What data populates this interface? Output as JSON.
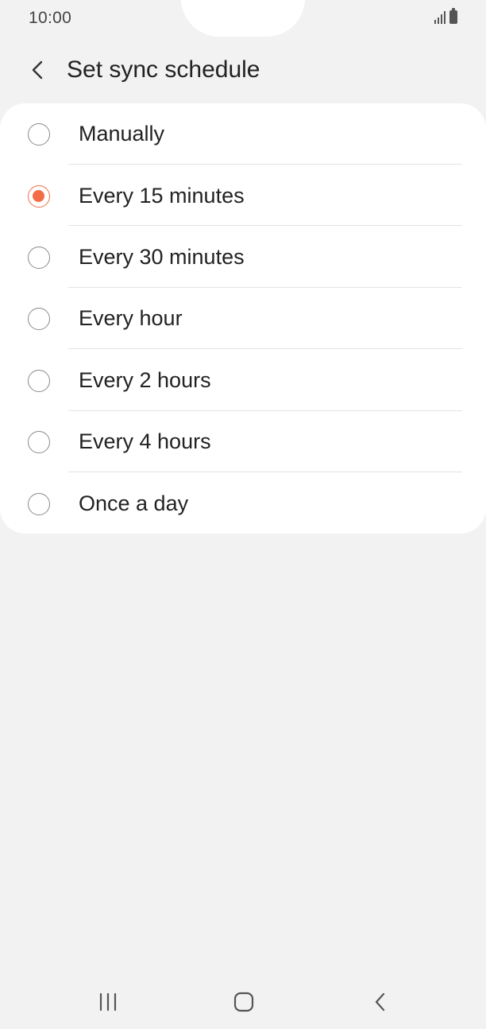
{
  "status_bar": {
    "time": "10:00"
  },
  "header": {
    "title": "Set sync schedule",
    "back_icon": "chevron-left-icon"
  },
  "options": [
    {
      "label": "Manually",
      "selected": false
    },
    {
      "label": "Every 15 minutes",
      "selected": true
    },
    {
      "label": "Every 30 minutes",
      "selected": false
    },
    {
      "label": "Every hour",
      "selected": false
    },
    {
      "label": "Every 2 hours",
      "selected": false
    },
    {
      "label": "Every 4 hours",
      "selected": false
    },
    {
      "label": "Once a day",
      "selected": false
    }
  ],
  "colors": {
    "accent": "#f26d47",
    "background": "#f2f2f2",
    "card": "#ffffff"
  },
  "nav_bar": {
    "recents_icon": "recents-icon",
    "home_icon": "home-icon",
    "back_icon": "back-icon"
  }
}
